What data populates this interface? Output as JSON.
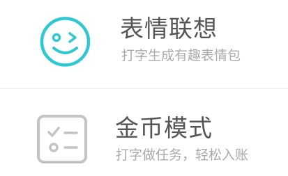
{
  "menu": {
    "items": [
      {
        "title": "表情联想",
        "subtitle": "打字生成有趣表情包",
        "icon": "smiley-wink-icon",
        "icon_color": "#2ec8d2",
        "title_color": "#555555",
        "subtitle_color": "#aaaaaa"
      },
      {
        "title": "金币模式",
        "subtitle": "打字做任务，轻松入账",
        "icon": "checklist-icon",
        "icon_color": "#c4c4c4",
        "title_color": "#555555",
        "subtitle_color": "#aaaaaa"
      }
    ]
  }
}
